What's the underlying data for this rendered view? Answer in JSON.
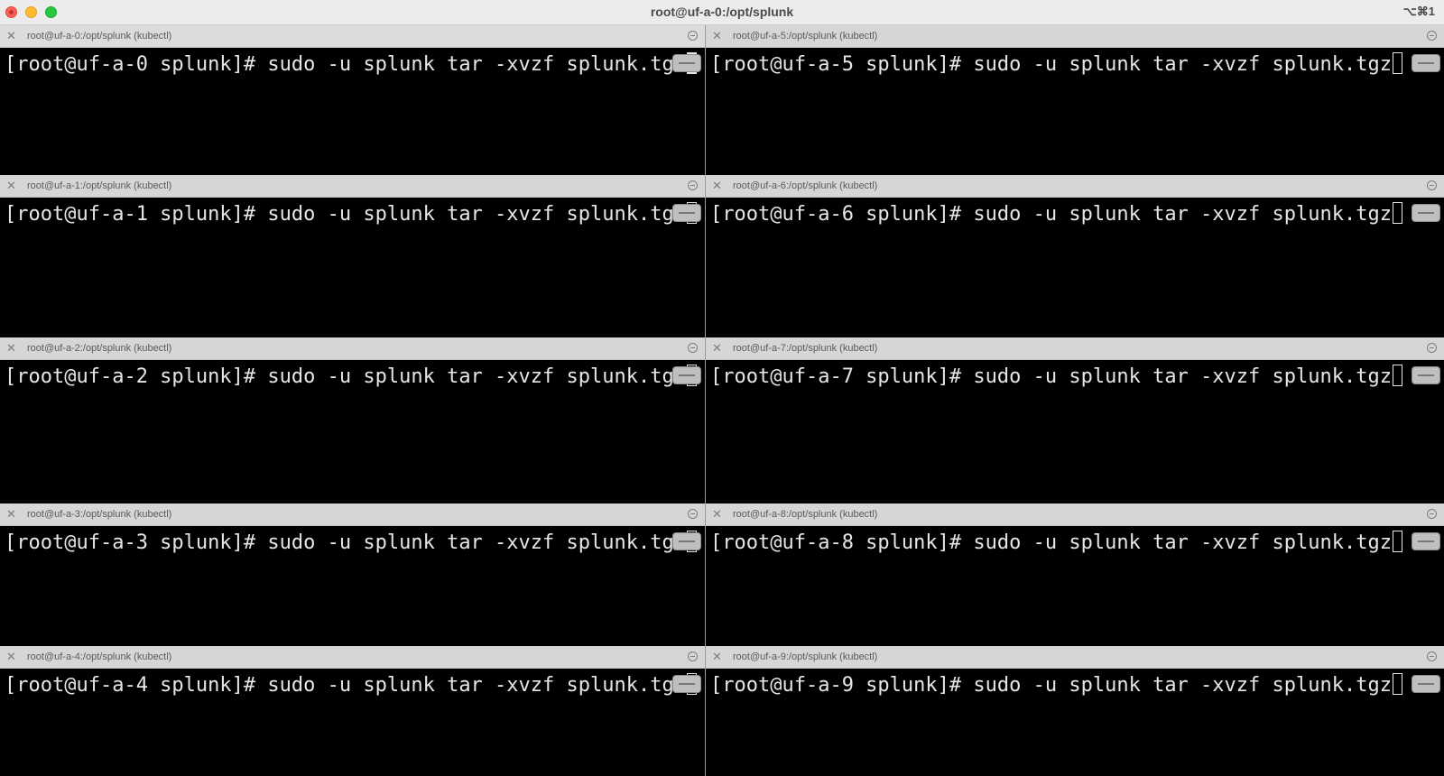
{
  "window": {
    "title": "root@uf-a-0:/opt/splunk",
    "shortcut": "⌥⌘1"
  },
  "panes": [
    {
      "title": "root@uf-a-0:/opt/splunk (kubectl)",
      "prompt": "[root@uf-a-0 splunk]# sudo -u splunk tar -xvzf splunk.tgz"
    },
    {
      "title": "root@uf-a-1:/opt/splunk (kubectl)",
      "prompt": "[root@uf-a-1 splunk]# sudo -u splunk tar -xvzf splunk.tgz"
    },
    {
      "title": "root@uf-a-2:/opt/splunk (kubectl)",
      "prompt": "[root@uf-a-2 splunk]# sudo -u splunk tar -xvzf splunk.tgz"
    },
    {
      "title": "root@uf-a-3:/opt/splunk (kubectl)",
      "prompt": "[root@uf-a-3 splunk]# sudo -u splunk tar -xvzf splunk.tgz"
    },
    {
      "title": "root@uf-a-4:/opt/splunk (kubectl)",
      "prompt": "[root@uf-a-4 splunk]# sudo -u splunk tar -xvzf splunk.tgz"
    },
    {
      "title": "root@uf-a-5:/opt/splunk (kubectl)",
      "prompt": "[root@uf-a-5 splunk]# sudo -u splunk tar -xvzf splunk.tgz"
    },
    {
      "title": "root@uf-a-6:/opt/splunk (kubectl)",
      "prompt": "[root@uf-a-6 splunk]# sudo -u splunk tar -xvzf splunk.tgz"
    },
    {
      "title": "root@uf-a-7:/opt/splunk (kubectl)",
      "prompt": "[root@uf-a-7 splunk]# sudo -u splunk tar -xvzf splunk.tgz"
    },
    {
      "title": "root@uf-a-8:/opt/splunk (kubectl)",
      "prompt": "[root@uf-a-8 splunk]# sudo -u splunk tar -xvzf splunk.tgz"
    },
    {
      "title": "root@uf-a-9:/opt/splunk (kubectl)",
      "prompt": "[root@uf-a-9 splunk]# sudo -u splunk tar -xvzf splunk.tgz"
    }
  ]
}
